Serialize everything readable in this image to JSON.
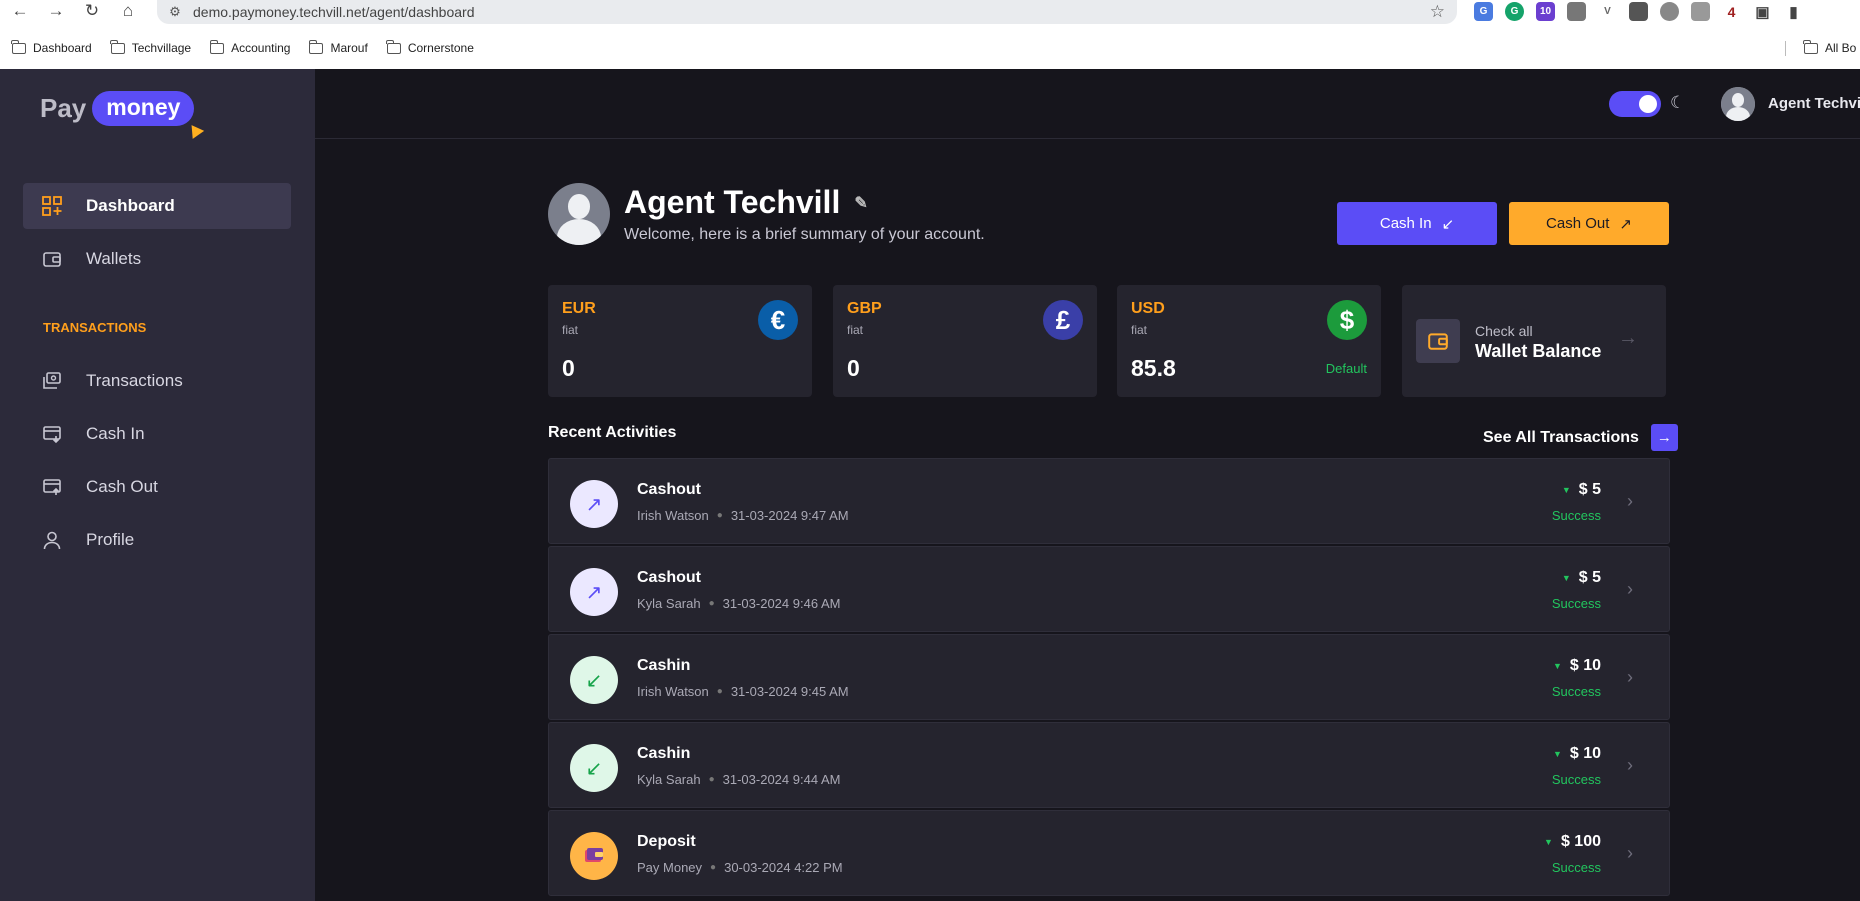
{
  "browser": {
    "url": "demo.paymoney.techvill.net/agent/dashboard",
    "bookmarks": [
      "Dashboard",
      "Techvillage",
      "Accounting",
      "Marouf",
      "Cornerstone"
    ],
    "all_bookmarks": "All Bo",
    "ext_badge": "10",
    "ext_badge2": "4"
  },
  "logo": {
    "pay": "Pay",
    "money": "money"
  },
  "sidebar": {
    "items": [
      {
        "label": "Dashboard"
      },
      {
        "label": "Wallets"
      },
      {
        "label": "Transactions"
      },
      {
        "label": "Cash In"
      },
      {
        "label": "Cash Out"
      },
      {
        "label": "Profile"
      }
    ],
    "section_label": "TRANSACTIONS"
  },
  "topbar": {
    "user_name": "Agent Techvill"
  },
  "profile": {
    "name": "Agent Techvill",
    "subtitle": "Welcome, here is a brief summary of your account.",
    "cash_in_label": "Cash In",
    "cash_out_label": "Cash Out"
  },
  "wallets": [
    {
      "currency": "EUR",
      "type": "fiat",
      "balance": "0",
      "symbol": "€",
      "color": "#0a5ea8"
    },
    {
      "currency": "GBP",
      "type": "fiat",
      "balance": "0",
      "symbol": "£",
      "color": "#3a3fa8"
    },
    {
      "currency": "USD",
      "type": "fiat",
      "balance": "85.8",
      "symbol": "$",
      "color": "#1c9b3c",
      "default_label": "Default"
    }
  ],
  "check_wallet": {
    "line1": "Check all",
    "line2": "Wallet Balance"
  },
  "recent": {
    "title": "Recent Activities",
    "see_all": "See All Transactions",
    "rows": [
      {
        "title": "Cashout",
        "name": "Irish Watson",
        "date": "31-03-2024 9:47 AM",
        "amount": "$ 5",
        "status": "Success"
      },
      {
        "title": "Cashout",
        "name": "Kyla Sarah",
        "date": "31-03-2024 9:46 AM",
        "amount": "$ 5",
        "status": "Success"
      },
      {
        "title": "Cashin",
        "name": "Irish Watson",
        "date": "31-03-2024 9:45 AM",
        "amount": "$ 10",
        "status": "Success"
      },
      {
        "title": "Cashin",
        "name": "Kyla Sarah",
        "date": "31-03-2024 9:44 AM",
        "amount": "$ 10",
        "status": "Success"
      },
      {
        "title": "Deposit",
        "name": "Pay Money",
        "date": "30-03-2024 4:22 PM",
        "amount": "$ 100",
        "status": "Success"
      }
    ]
  },
  "colors": {
    "accent": "#5b4df6",
    "orange": "#ffaa2b",
    "success": "#22c55e"
  }
}
